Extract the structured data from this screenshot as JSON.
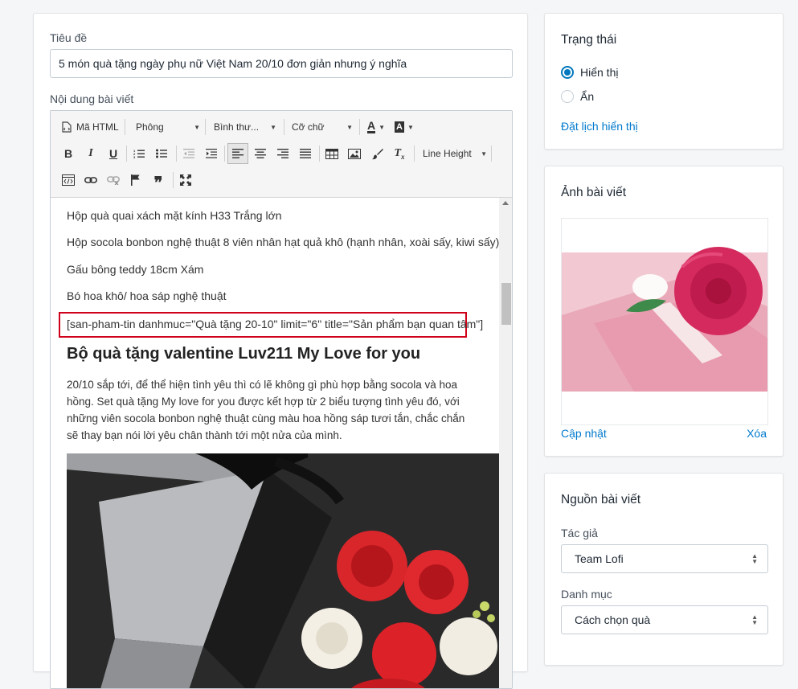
{
  "main": {
    "title_label": "Tiêu đề",
    "title_value": "5 món quà tặng ngày phụ nữ Việt Nam 20/10 đơn giản nhưng ý nghĩa",
    "content_label": "Nội dung bài viết",
    "toolbar": {
      "html_label": "Mã HTML",
      "font_label": "Phông",
      "format_label": "Bình thư...",
      "size_label": "Cỡ chữ",
      "line_height_label": "Line Height"
    },
    "content": {
      "lines": [
        "Hộp quà quai xách mặt kính H33 Trắng lớn",
        "Hộp socola bonbon nghệ thuật 8 viên nhân hạt quả khô (hạnh nhân, xoài sấy, kiwi sấy)",
        "Gấu bông teddy 18cm Xám",
        "Bó hoa khô/ hoa sáp nghệ thuật"
      ],
      "shortcode": "[san-pham-tin danhmuc=\"Quà tặng 20-10\" limit=\"6\" title=\"Sản phẩm bạn quan tâm\"]",
      "heading": "Bộ quà tặng valentine Luv211 My Love for you",
      "paragraph": "20/10 sắp tới, để thể hiện tình yêu thì có lẽ không gì phù hợp bằng socola và hoa hồng. Set quà tặng My love for you được kết hợp từ 2 biểu tượng tình yêu đó, với những viên socola bonbon nghệ thuật cùng màu hoa hồng sáp tươi tắn, chắc chắn sẽ thay bạn nói lời yêu chân thành tới một nửa của mình."
    }
  },
  "status": {
    "title": "Trạng thái",
    "options": [
      "Hiển thị",
      "Ẩn"
    ],
    "selected": "Hiển thị",
    "schedule_link": "Đặt lịch hiển thị"
  },
  "image": {
    "title": "Ảnh bài viết",
    "update_link": "Cập nhật",
    "delete_link": "Xóa"
  },
  "source": {
    "title": "Nguồn bài viết",
    "author_label": "Tác giả",
    "author_value": "Team Lofi",
    "category_label": "Danh mục",
    "category_value": "Cách chọn quà"
  },
  "colors": {
    "accent": "#007ace",
    "highlight": "#d0021b"
  }
}
